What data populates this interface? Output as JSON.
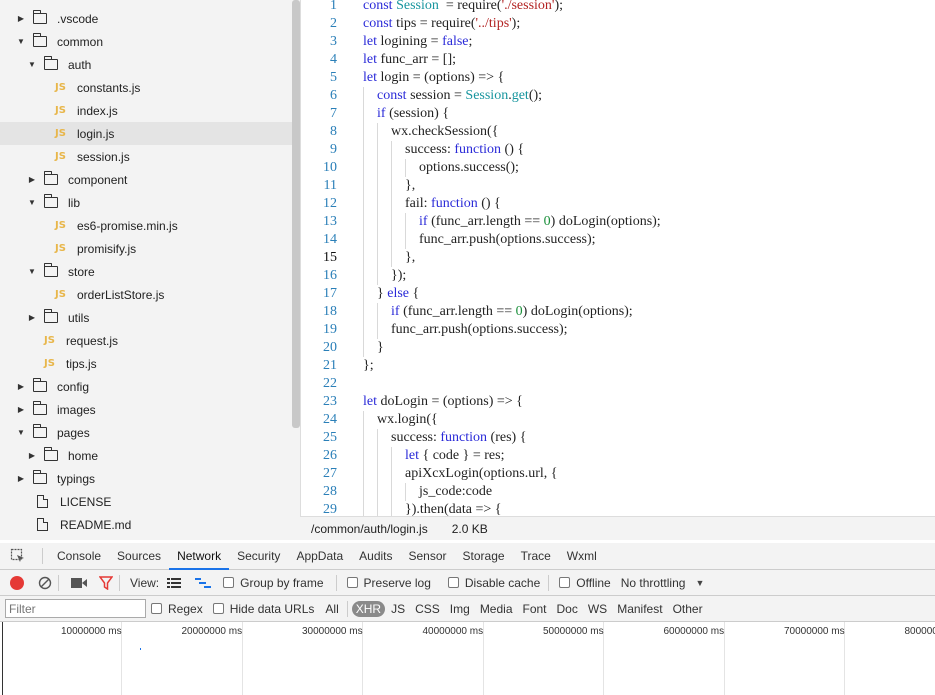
{
  "file_tree": {
    "items": [
      {
        "type": "folder",
        "label": ".vscode",
        "depth": 1,
        "expanded": false
      },
      {
        "type": "folder",
        "label": "common",
        "depth": 1,
        "expanded": true
      },
      {
        "type": "folder",
        "label": "auth",
        "depth": 2,
        "expanded": true
      },
      {
        "type": "js",
        "label": "constants.js",
        "depth": 3
      },
      {
        "type": "js",
        "label": "index.js",
        "depth": 3
      },
      {
        "type": "js",
        "label": "login.js",
        "depth": 3,
        "selected": true
      },
      {
        "type": "js",
        "label": "session.js",
        "depth": 3
      },
      {
        "type": "folder",
        "label": "component",
        "depth": 2,
        "expanded": false
      },
      {
        "type": "folder",
        "label": "lib",
        "depth": 2,
        "expanded": true
      },
      {
        "type": "js",
        "label": "es6-promise.min.js",
        "depth": 3
      },
      {
        "type": "js",
        "label": "promisify.js",
        "depth": 3
      },
      {
        "type": "folder",
        "label": "store",
        "depth": 2,
        "expanded": true
      },
      {
        "type": "js",
        "label": "orderListStore.js",
        "depth": 3
      },
      {
        "type": "folder",
        "label": "utils",
        "depth": 2,
        "expanded": false
      },
      {
        "type": "js",
        "label": "request.js",
        "depth": 2
      },
      {
        "type": "js",
        "label": "tips.js",
        "depth": 2
      },
      {
        "type": "folder",
        "label": "config",
        "depth": 1,
        "expanded": false
      },
      {
        "type": "folder",
        "label": "images",
        "depth": 1,
        "expanded": false
      },
      {
        "type": "folder",
        "label": "pages",
        "depth": 1,
        "expanded": true
      },
      {
        "type": "folder",
        "label": "home",
        "depth": 2,
        "expanded": false
      },
      {
        "type": "folder",
        "label": "typings",
        "depth": 1,
        "expanded": false
      },
      {
        "type": "file",
        "label": "LICENSE",
        "depth": 1
      },
      {
        "type": "file",
        "label": "README.md",
        "depth": 1
      }
    ]
  },
  "editor": {
    "current_line": 15,
    "lines": [
      {
        "n": "1",
        "indent": 0,
        "tokens": [
          [
            "kw",
            "const "
          ],
          [
            "cls",
            "Session"
          ],
          [
            "",
            "  = require("
          ],
          [
            "str",
            "'./session'"
          ],
          [
            "",
            ");"
          ]
        ]
      },
      {
        "n": "2",
        "indent": 0,
        "tokens": [
          [
            "kw",
            "const "
          ],
          [
            "",
            "tips = require("
          ],
          [
            "str",
            "'../tips'"
          ],
          [
            "",
            ");"
          ]
        ]
      },
      {
        "n": "3",
        "indent": 0,
        "tokens": [
          [
            "kw",
            "let "
          ],
          [
            "",
            "logining = "
          ],
          [
            "kw",
            "false"
          ],
          [
            "",
            ";"
          ]
        ]
      },
      {
        "n": "4",
        "indent": 0,
        "tokens": [
          [
            "kw",
            "let "
          ],
          [
            "",
            "func_arr = [];"
          ]
        ]
      },
      {
        "n": "5",
        "indent": 0,
        "tokens": [
          [
            "kw",
            "let "
          ],
          [
            "",
            "login = (options) => {"
          ]
        ]
      },
      {
        "n": "6",
        "indent": 1,
        "tokens": [
          [
            "kw",
            "const "
          ],
          [
            "",
            "session = "
          ],
          [
            "cls",
            "Session"
          ],
          [
            "",
            "."
          ],
          [
            "cls",
            "get"
          ],
          [
            "",
            "();"
          ]
        ]
      },
      {
        "n": "7",
        "indent": 1,
        "tokens": [
          [
            "kw",
            "if "
          ],
          [
            "",
            "(session) {"
          ]
        ]
      },
      {
        "n": "8",
        "indent": 2,
        "tokens": [
          [
            "",
            "wx.checkSession({"
          ]
        ]
      },
      {
        "n": "9",
        "indent": 3,
        "tokens": [
          [
            "",
            "success: "
          ],
          [
            "kw",
            "function "
          ],
          [
            "",
            "() {"
          ]
        ]
      },
      {
        "n": "10",
        "indent": 4,
        "tokens": [
          [
            "",
            "options.success();"
          ]
        ]
      },
      {
        "n": "11",
        "indent": 3,
        "tokens": [
          [
            "",
            "},"
          ]
        ]
      },
      {
        "n": "12",
        "indent": 3,
        "tokens": [
          [
            "",
            "fail: "
          ],
          [
            "kw",
            "function "
          ],
          [
            "",
            "() {"
          ]
        ]
      },
      {
        "n": "13",
        "indent": 4,
        "tokens": [
          [
            "kw",
            "if "
          ],
          [
            "",
            "(func_arr.length == "
          ],
          [
            "num",
            "0"
          ],
          [
            "",
            ") doLogin(options);"
          ]
        ]
      },
      {
        "n": "14",
        "indent": 4,
        "tokens": [
          [
            "",
            "func_arr.push(options.success);"
          ]
        ]
      },
      {
        "n": "15",
        "indent": 3,
        "tokens": [
          [
            "",
            "},"
          ]
        ]
      },
      {
        "n": "16",
        "indent": 2,
        "tokens": [
          [
            "",
            "});"
          ]
        ]
      },
      {
        "n": "17",
        "indent": 1,
        "tokens": [
          [
            "",
            "} "
          ],
          [
            "kw",
            "else "
          ],
          [
            "",
            "{"
          ]
        ]
      },
      {
        "n": "18",
        "indent": 2,
        "tokens": [
          [
            "kw",
            "if "
          ],
          [
            "",
            "(func_arr.length == "
          ],
          [
            "num",
            "0"
          ],
          [
            "",
            ") doLogin(options);"
          ]
        ]
      },
      {
        "n": "19",
        "indent": 2,
        "tokens": [
          [
            "",
            "func_arr.push(options.success);"
          ]
        ]
      },
      {
        "n": "20",
        "indent": 1,
        "tokens": [
          [
            "",
            "}"
          ]
        ]
      },
      {
        "n": "21",
        "indent": 0,
        "tokens": [
          [
            "",
            "};"
          ]
        ]
      },
      {
        "n": "22",
        "indent": 0,
        "tokens": []
      },
      {
        "n": "23",
        "indent": 0,
        "tokens": [
          [
            "kw",
            "let "
          ],
          [
            "",
            "doLogin = (options) => {"
          ]
        ]
      },
      {
        "n": "24",
        "indent": 1,
        "tokens": [
          [
            "",
            "wx.login({"
          ]
        ]
      },
      {
        "n": "25",
        "indent": 2,
        "tokens": [
          [
            "",
            "success: "
          ],
          [
            "kw",
            "function "
          ],
          [
            "",
            "(res) {"
          ]
        ]
      },
      {
        "n": "26",
        "indent": 3,
        "tokens": [
          [
            "kw",
            "let "
          ],
          [
            "",
            "{ code } = res;"
          ]
        ]
      },
      {
        "n": "27",
        "indent": 3,
        "tokens": [
          [
            "",
            "apiXcxLogin(options.url, {"
          ]
        ]
      },
      {
        "n": "28",
        "indent": 4,
        "tokens": [
          [
            "",
            "js_code:code"
          ]
        ]
      },
      {
        "n": "29",
        "indent": 3,
        "tokens": [
          [
            "",
            "}).then(data => {"
          ]
        ]
      }
    ]
  },
  "status_bar": {
    "path": "/common/auth/login.js",
    "size": "2.0 KB"
  },
  "devtools": {
    "tabs": [
      "Console",
      "Sources",
      "Network",
      "Security",
      "AppData",
      "Audits",
      "Sensor",
      "Storage",
      "Trace",
      "Wxml"
    ],
    "active_tab": "Network",
    "toolbar": {
      "view_label": "View:",
      "group_by_frame": "Group by frame",
      "preserve_log": "Preserve log",
      "disable_cache": "Disable cache",
      "offline": "Offline",
      "throttling": "No throttling"
    },
    "filter": {
      "placeholder": "Filter",
      "regex": "Regex",
      "hide_data_urls": "Hide data URLs",
      "types": [
        "All",
        "XHR",
        "JS",
        "CSS",
        "Img",
        "Media",
        "Font",
        "Doc",
        "WS",
        "Manifest",
        "Other"
      ],
      "active_type": "XHR"
    },
    "timeline_ticks": [
      "10000000 ms",
      "20000000 ms",
      "30000000 ms",
      "40000000 ms",
      "50000000 ms",
      "60000000 ms",
      "70000000 ms",
      "800000"
    ]
  },
  "colors": {
    "keyword": "#2a2ad8",
    "class": "#17959e",
    "string": "#b22222",
    "number": "#1a8f3a",
    "line_number": "#2a7fb8",
    "js_icon": "#e8b64a",
    "record_button": "#e53935",
    "active_tab_underline": "#1a73e8"
  }
}
